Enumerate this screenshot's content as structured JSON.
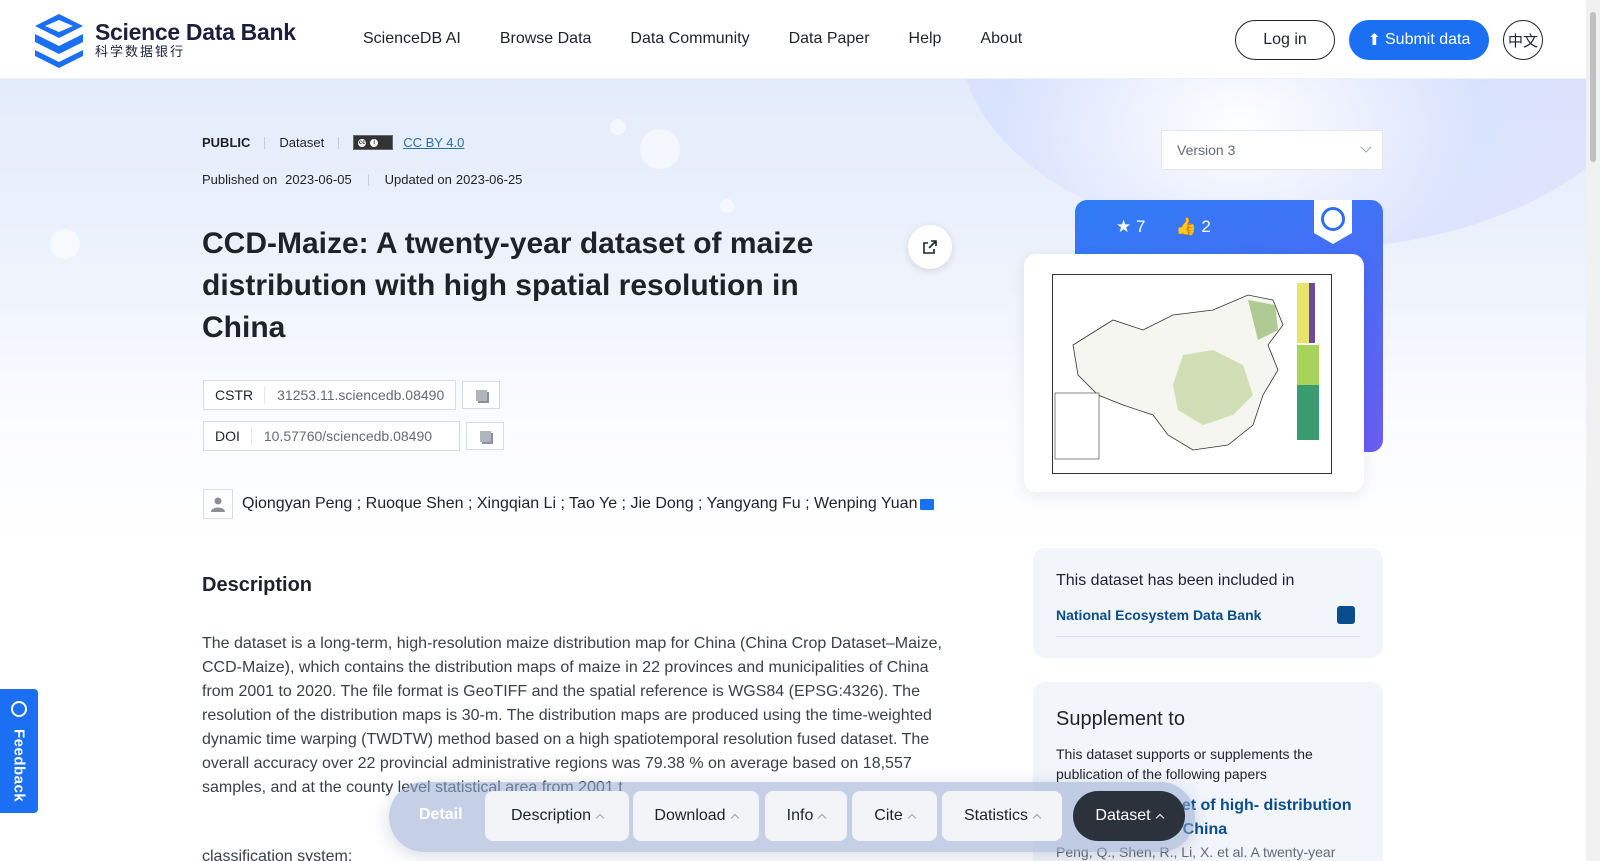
{
  "header": {
    "logo_en": "Science Data Bank",
    "logo_cn": "科学数据银行",
    "nav": [
      "ScienceDB AI",
      "Browse Data",
      "Data Community",
      "Data Paper",
      "Help",
      "About"
    ],
    "login": "Log in",
    "submit": "Submit data",
    "lang": "中文"
  },
  "meta": {
    "visibility": "PUBLIC",
    "type": "Dataset",
    "license": "CC BY 4.0",
    "published_label": "Published on",
    "published": "2023-06-05",
    "updated_label": "Updated on",
    "updated": "2023-06-25"
  },
  "title": "CCD-Maize: A twenty-year dataset of maize distribution with high spatial resolution in China",
  "ids": {
    "cstr_label": "CSTR",
    "cstr": "31253.11.sciencedb.08490",
    "doi_label": "DOI",
    "doi": "10.57760/sciencedb.08490"
  },
  "authors": "Qiongyan Peng ; Ruoque Shen ; Xingqian Li ; Tao Ye ; Jie Dong ; Yangyang Fu ; Wenping Yuan",
  "description": {
    "heading": "Description",
    "text": "The dataset is a long-term, high-resolution maize distribution map for China (China Crop Dataset–Maize, CCD-Maize), which contains the distribution maps of maize in 22 provinces and municipalities of China from 2001 to 2020. The file format is GeoTIFF and the spatial reference is WGS84 (EPSG:4326). The resolution of the distribution maps is 30-m. The distribution maps are produced using the time-weighted dynamic time warping (TWDTW) method based on a high spatiotemporal resolution fused dataset. The overall accuracy over 22 provincial administrative regions was 79.38 % on average based on 18,557 samples, and at the county level statistical area from 2001 t",
    "next": "classification system:"
  },
  "right": {
    "version": "Version 3",
    "stars": "7",
    "likes": "2",
    "included_title": "This dataset has been included in",
    "included_link": "National Ecosystem Data Bank",
    "supplement_title": "Supplement to",
    "supplement_text": "This dataset supports or supplements the publication of the following papers",
    "supplement_link": "aset of high- distribution in China",
    "supplement_ref": "Peng, Q., Shen, R., Li, X. et al. A twenty-year"
  },
  "feedback": "Feedback",
  "dock": {
    "label": "Detail",
    "buttons": [
      "Description",
      "Download",
      "Info",
      "Cite",
      "Statistics",
      "Dataset"
    ]
  },
  "colors": {
    "primary": "#1a6ff2",
    "link": "#0a4d8c",
    "dark": "#2b323c"
  }
}
